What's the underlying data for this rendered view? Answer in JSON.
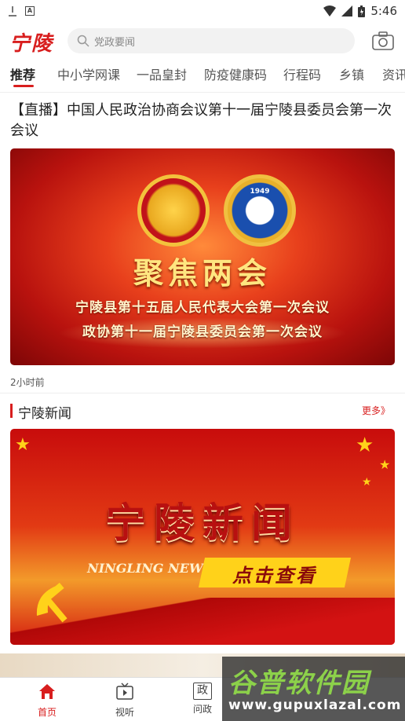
{
  "status_bar": {
    "time": "5:46"
  },
  "header": {
    "logo": "宁陵",
    "search_placeholder": "党政要闻"
  },
  "tabs": [
    "推荐",
    "中小学网课",
    "一品皇封",
    "防疫健康码",
    "行程码",
    "乡镇",
    "资讯"
  ],
  "article": {
    "title": "【直播】中国人民政治协商会议第十一届宁陵县委员会第一次会议",
    "banner_title": "聚焦两会",
    "banner_line1": "宁陵县第十五届人民代表大会第一次会议",
    "banner_line2": "政协第十一届宁陵县委员会第一次会议",
    "emblem_year": "1949",
    "time_ago": "2小时前"
  },
  "section": {
    "title": "宁陵新闻",
    "more": "更多》",
    "banner_title": "宁陵新闻",
    "banner_en": "NINGLING NEWS",
    "banner_cta": "点击查看"
  },
  "bottom_nav": [
    {
      "label": "首页",
      "icon": "home-icon",
      "active": true
    },
    {
      "label": "视听",
      "icon": "tv-icon",
      "active": false
    },
    {
      "label": "问政",
      "icon": "zheng-icon",
      "active": false
    }
  ],
  "watermark": {
    "title": "谷普软件园",
    "url": "www.gupuxlazal.com"
  },
  "colors": {
    "accent": "#d81e1e"
  }
}
